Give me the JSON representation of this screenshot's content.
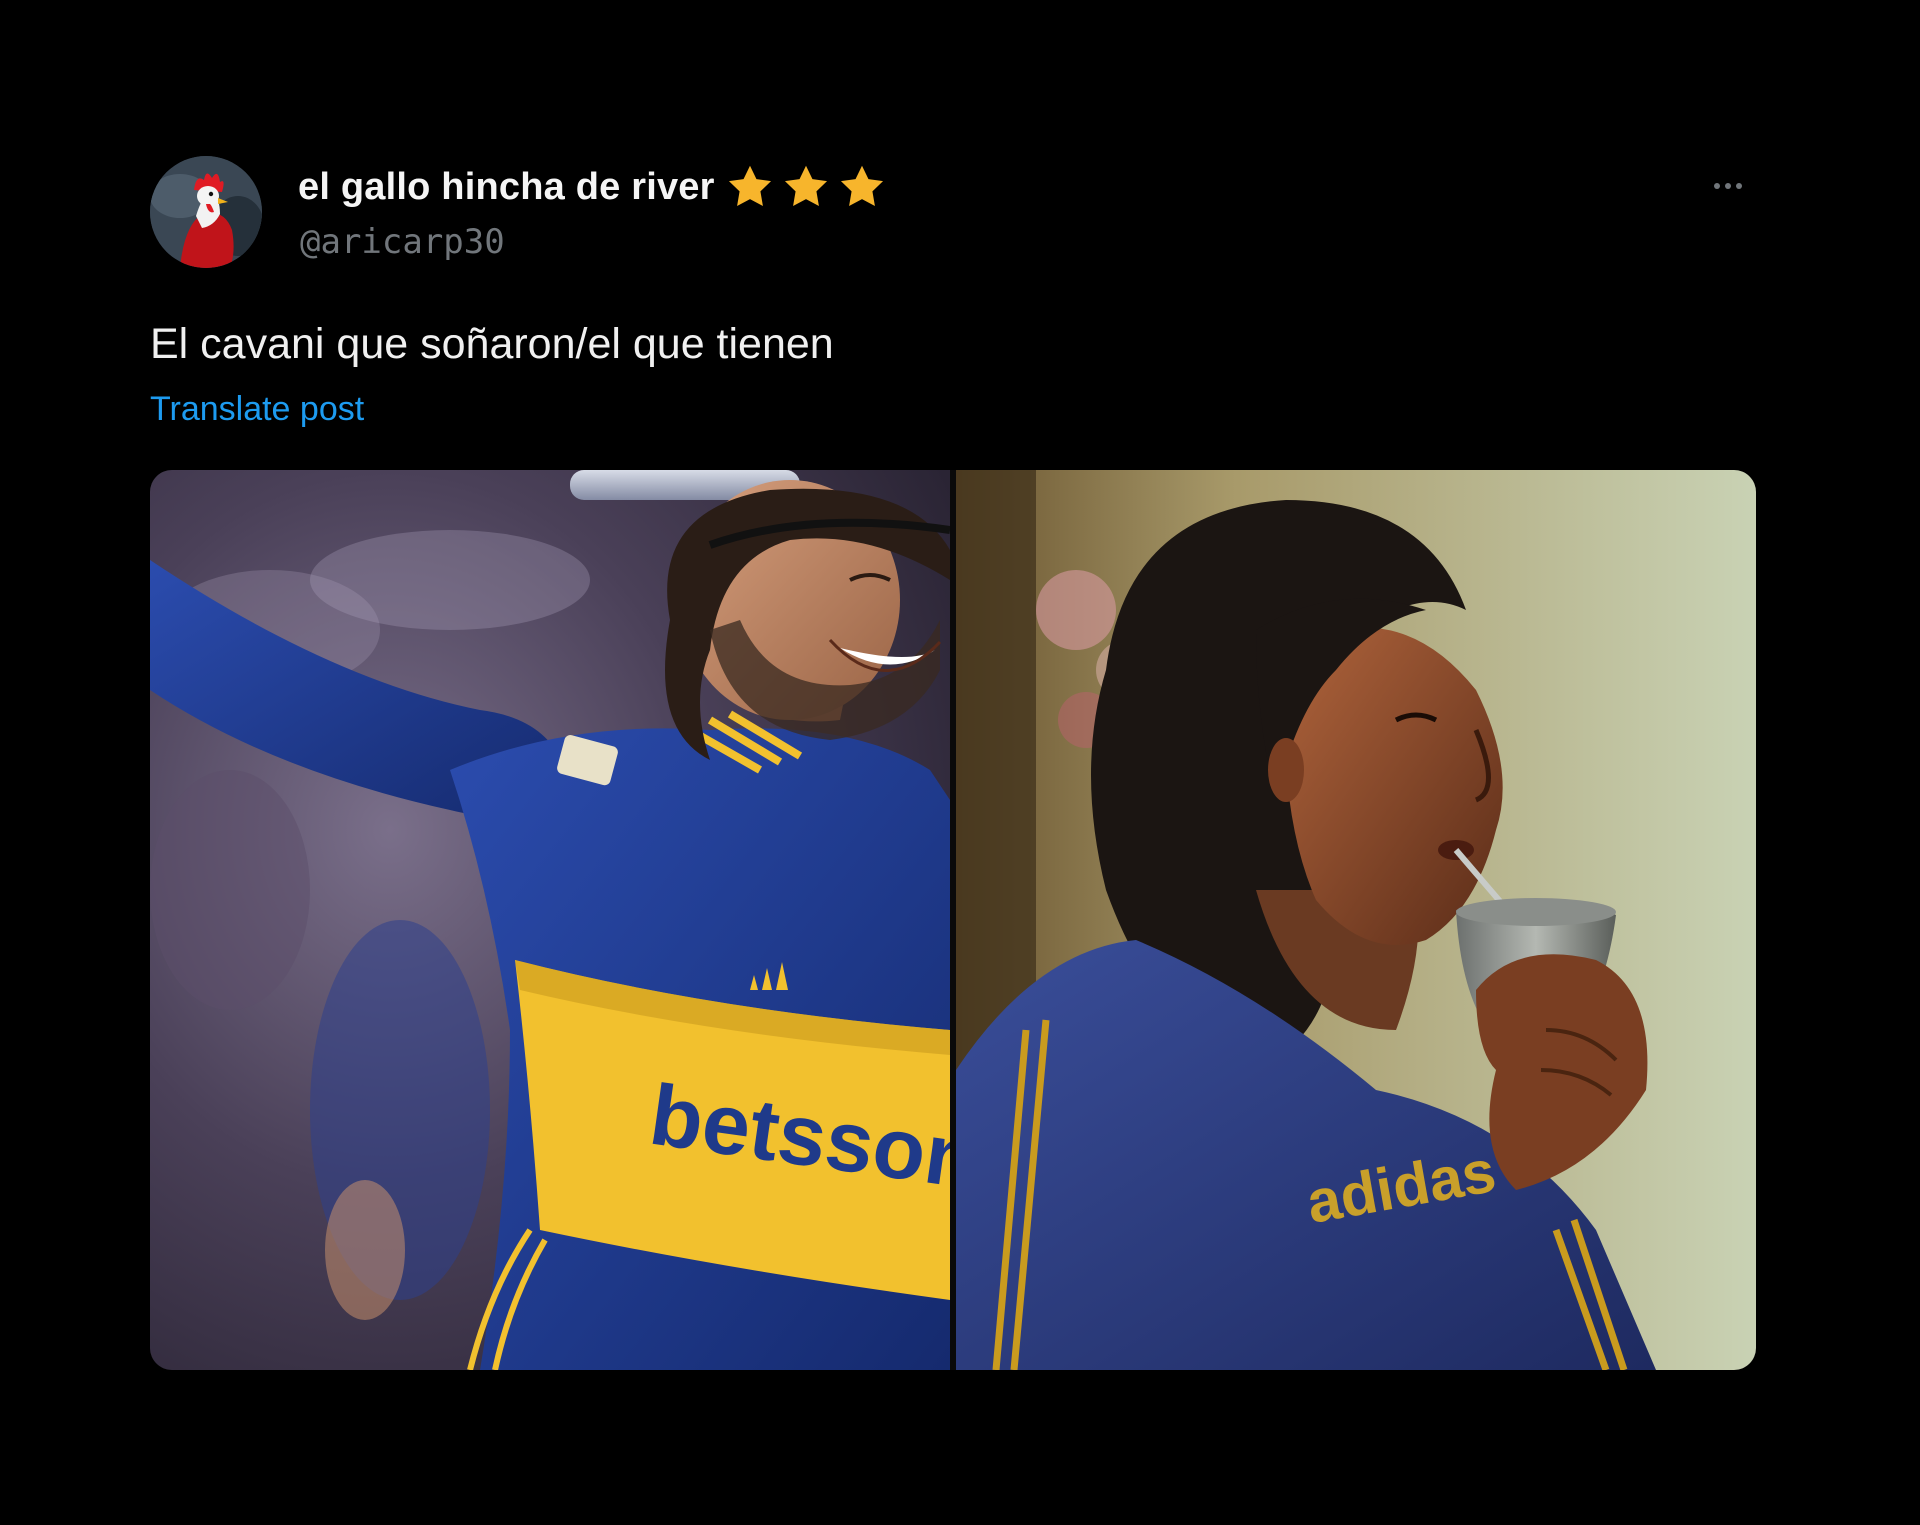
{
  "post": {
    "display_name": "el gallo hincha de river",
    "handle": "@aricarp30",
    "text": "El cavani que soñaron/el que tienen",
    "translate_label": "Translate post",
    "badge_icons": [
      "star-icon",
      "star-icon",
      "star-icon"
    ],
    "more_icon": "more-options-icon"
  },
  "media": {
    "left_photo": {
      "jersey_sponsor": "betsson"
    },
    "right_photo": {
      "jersey_brand": "adidas"
    }
  },
  "colors": {
    "background": "#000000",
    "link": "#1d9bf0",
    "handle": "#71767b",
    "star": "#f7b52c",
    "boca_blue": "#1f3a8a",
    "boca_gold": "#f2c12e"
  }
}
